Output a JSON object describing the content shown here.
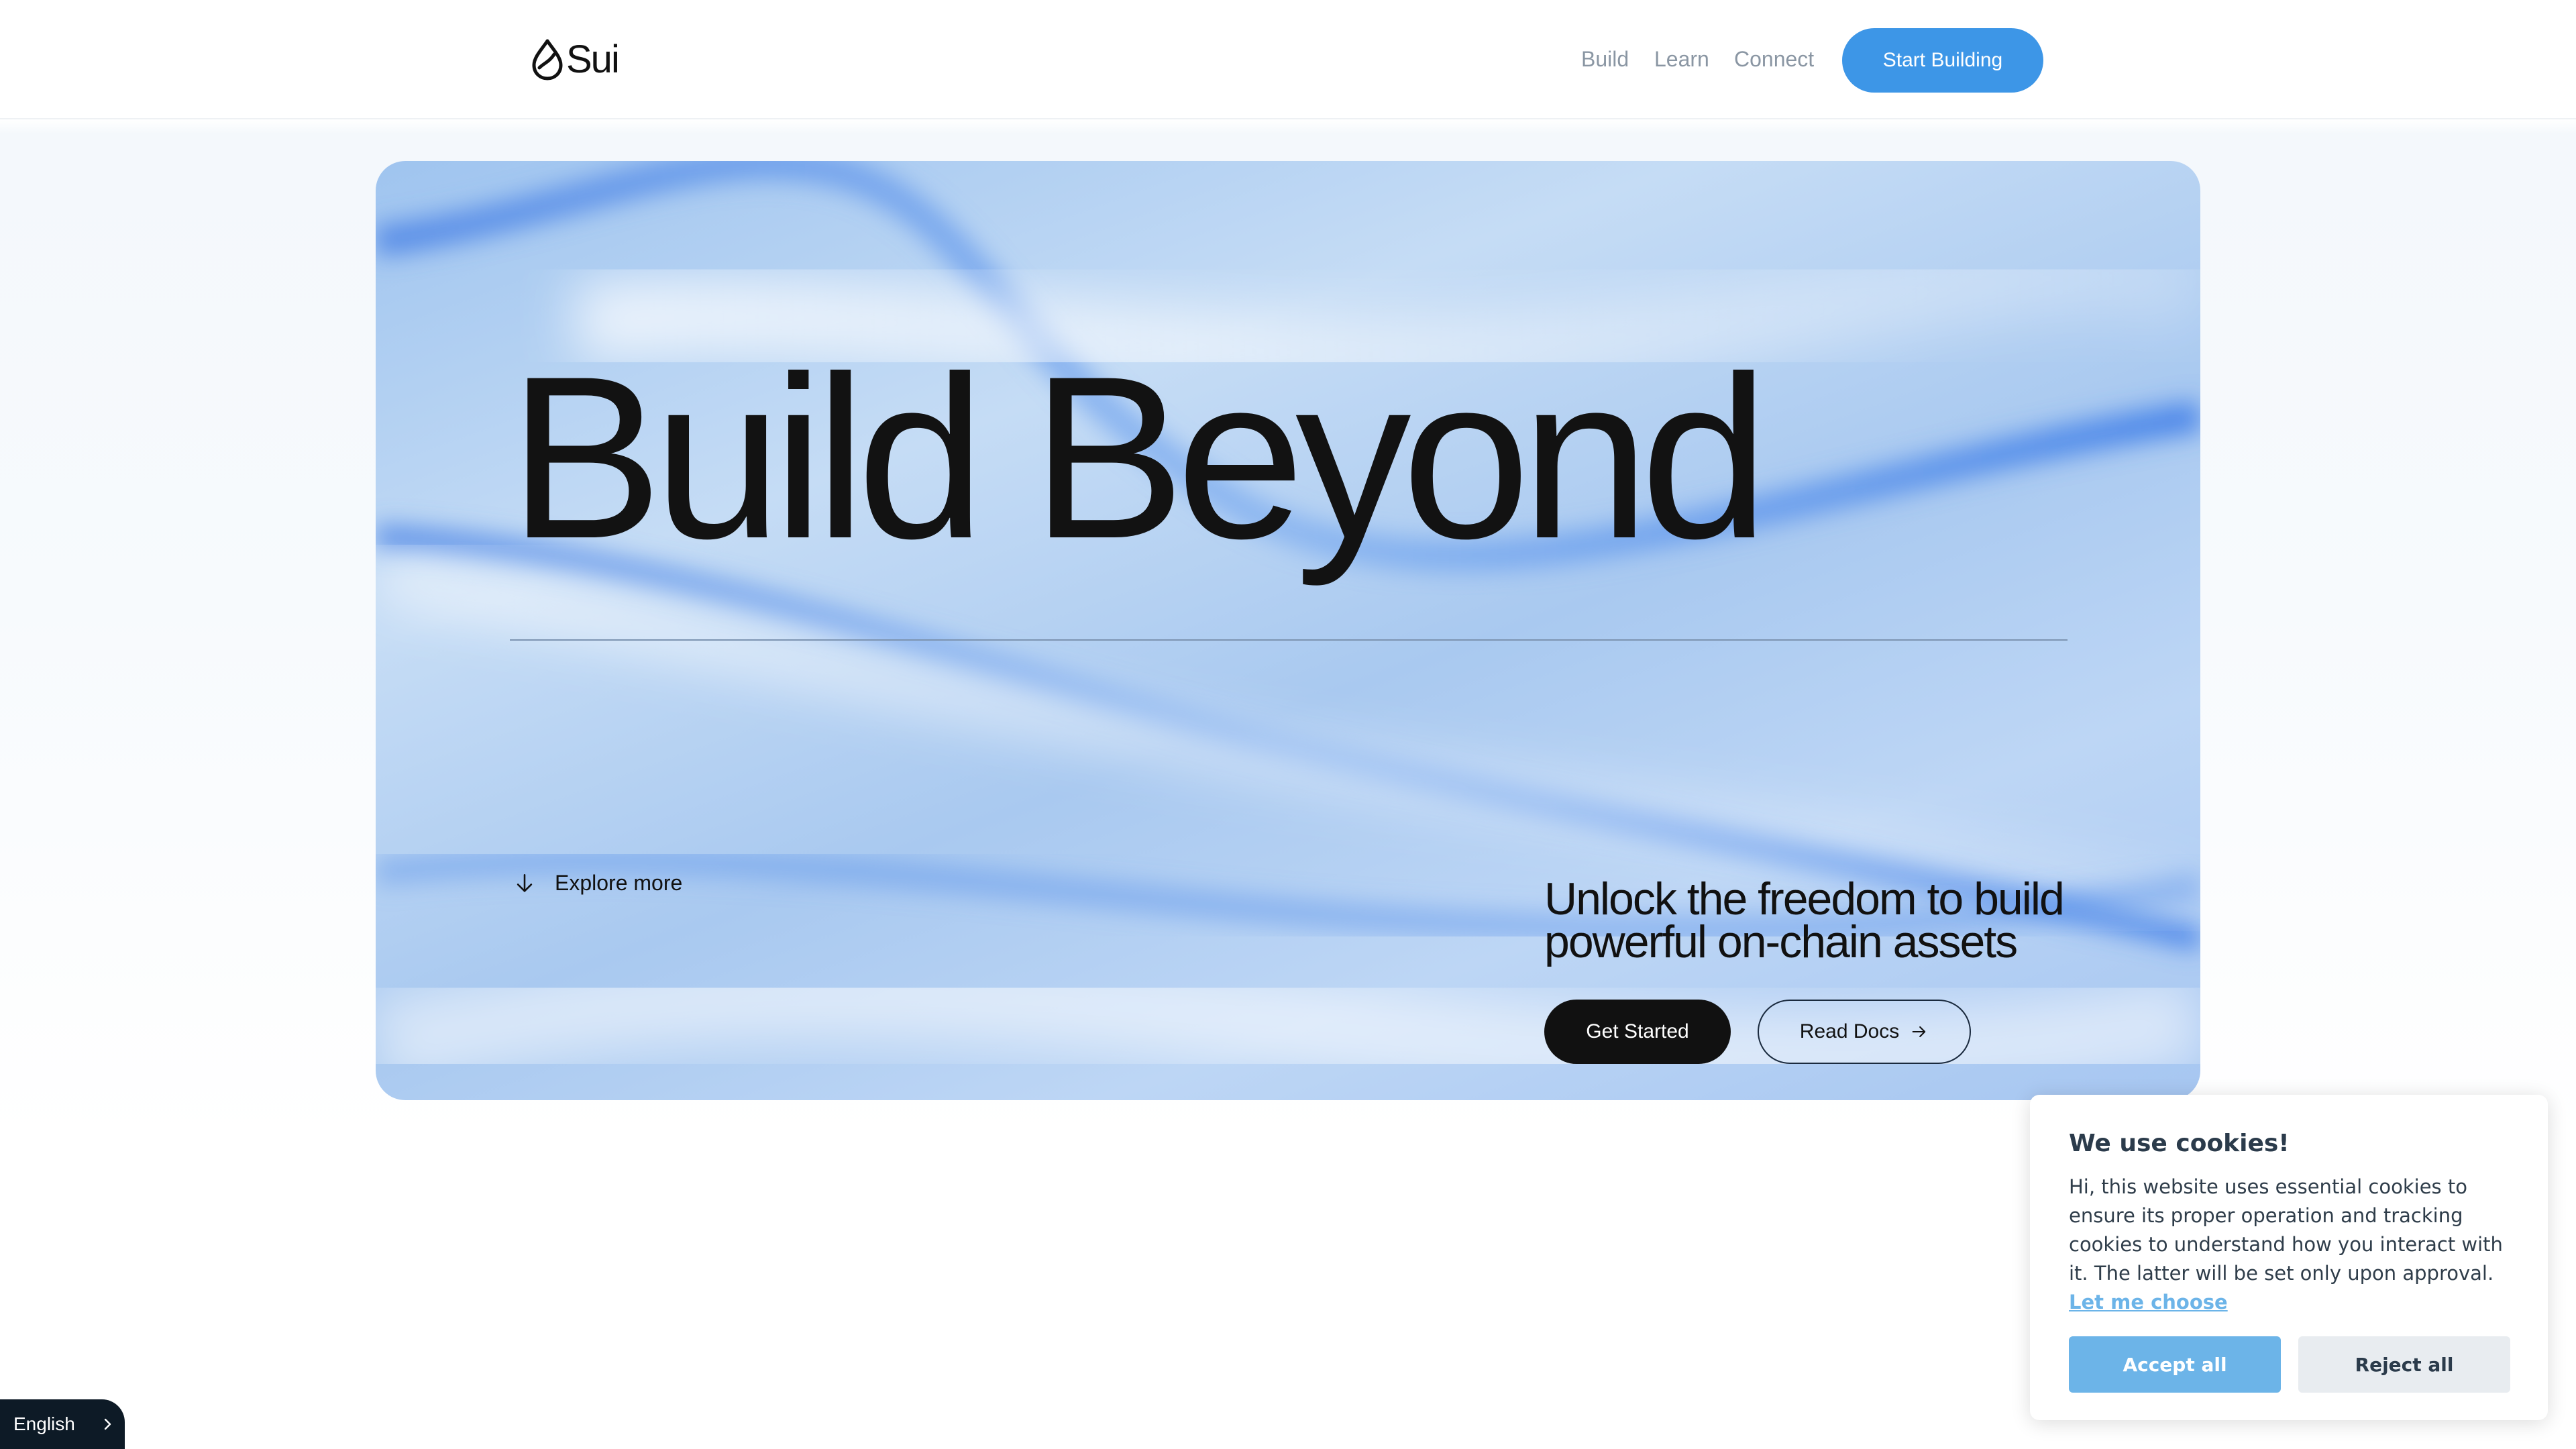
{
  "header": {
    "logo_text": "Sui",
    "nav": {
      "build": "Build",
      "learn": "Learn",
      "connect": "Connect"
    },
    "cta_label": "Start Building"
  },
  "hero": {
    "title": "Build Beyond",
    "explore_label": "Explore more",
    "tagline_line1": "Unlock the freedom to build",
    "tagline_line2": "powerful on-chain assets",
    "get_started_label": "Get Started",
    "read_docs_label": "Read Docs"
  },
  "cookie": {
    "title": "We use cookies!",
    "body": "Hi, this website uses essential cookies to ensure its proper operation and tracking cookies to understand how you interact with it. The latter will be set only upon approval. ",
    "link": "Let me choose",
    "accept_label": "Accept all",
    "reject_label": "Reject all"
  },
  "language": {
    "current": "English"
  },
  "colors": {
    "brand_blue": "#3d96e7",
    "cookie_accent": "#6cb4e8",
    "dark": "#111111"
  },
  "icons": [
    "sui-drop-logo-icon",
    "arrow-down-icon",
    "arrow-right-icon",
    "chevron-right-icon"
  ]
}
